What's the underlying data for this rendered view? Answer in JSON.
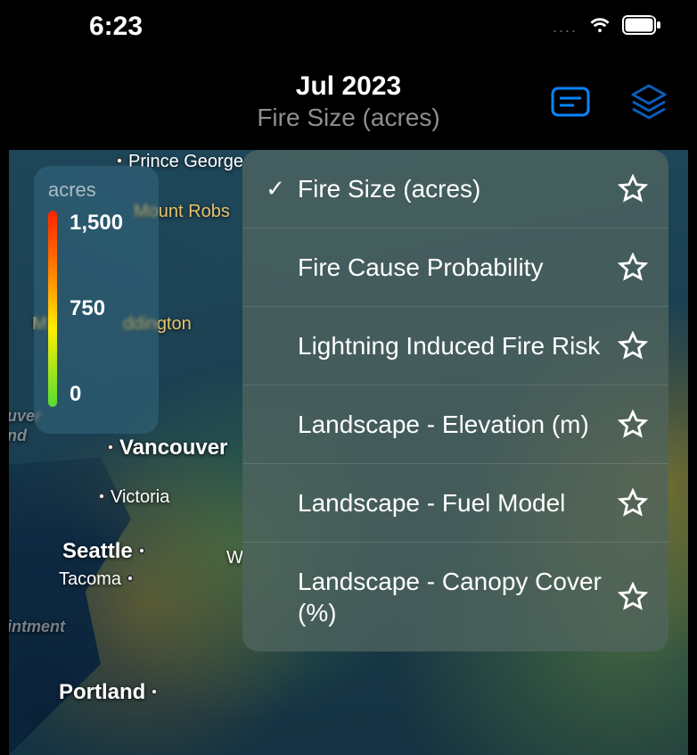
{
  "status": {
    "time": "6:23",
    "dots": "....",
    "wifi": true,
    "battery_full": true
  },
  "header": {
    "title": "Jul 2023",
    "subtitle": "Fire Size (acres)"
  },
  "legend": {
    "title": "acres",
    "max": "1,500",
    "mid": "750",
    "min": "0"
  },
  "map_labels": {
    "prince_george": "Prince George",
    "mount_robs": "Mount Robs",
    "waddington": "ddington",
    "mt_w_prefix": "M",
    "vancouver": "Vancouver",
    "victoria": "Victoria",
    "seattle": "Seattle",
    "tacoma": "Tacoma",
    "portland": "Portland",
    "intment": "intment",
    "uver": "uver",
    "nd": "nd",
    "w": "W"
  },
  "menu": {
    "items": [
      {
        "label": "Fire Size (acres)",
        "selected": true
      },
      {
        "label": "Fire Cause Probability",
        "selected": false
      },
      {
        "label": "Lightning Induced Fire Risk",
        "selected": false
      },
      {
        "label": "Landscape - Elevation (m)",
        "selected": false
      },
      {
        "label": "Landscape - Fuel Model",
        "selected": false
      },
      {
        "label": "Landscape - Canopy Cover (%)",
        "selected": false
      }
    ]
  },
  "colors": {
    "accent": "#0a84ff"
  }
}
